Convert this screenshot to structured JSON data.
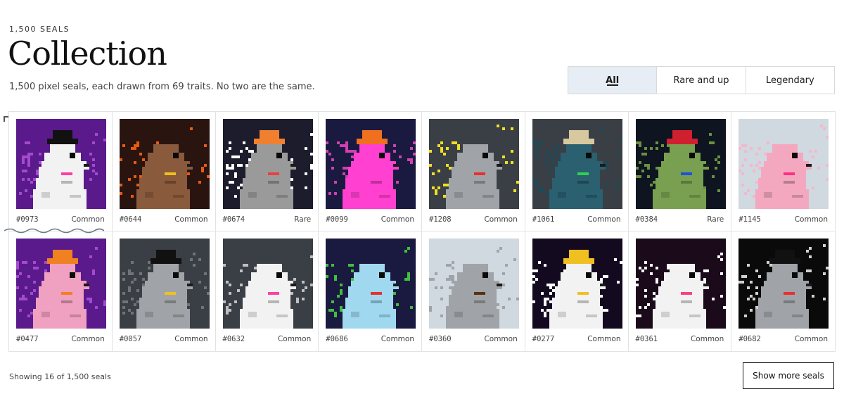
{
  "header": {
    "eyebrow": "1,500 SEALS",
    "title": "Collection",
    "subtitle": "1,500 pixel seals, each drawn from 69 traits. No two are the same."
  },
  "filters": [
    {
      "label": "All",
      "active": true
    },
    {
      "label": "Rare and up",
      "active": false
    },
    {
      "label": "Legendary",
      "active": false
    }
  ],
  "seals": [
    {
      "id": "#0973",
      "rarity": "Common",
      "bg": "#5a1a8c",
      "body": "#f2f2f2",
      "accent": "#ff3fa0",
      "hat": "#111111",
      "trail": "#a34ad0"
    },
    {
      "id": "#0644",
      "rarity": "Common",
      "bg": "#2a1410",
      "body": "#8a5a3c",
      "accent": "#f0c020",
      "hat": "",
      "trail": "#e85a10"
    },
    {
      "id": "#0674",
      "rarity": "Rare",
      "bg": "#1c1c2c",
      "body": "#9a9a9a",
      "accent": "#e84040",
      "hat": "#f08030",
      "trail": "#ffffff"
    },
    {
      "id": "#0099",
      "rarity": "Common",
      "bg": "#1a1a40",
      "body": "#ff40d0",
      "accent": "#ff40d0",
      "hat": "#f07020",
      "trail": "#d040b0"
    },
    {
      "id": "#1208",
      "rarity": "Common",
      "bg": "#3a3f46",
      "body": "#a0a4a8",
      "accent": "#e83030",
      "hat": "",
      "trail": "#f0e020"
    },
    {
      "id": "#1061",
      "rarity": "Common",
      "bg": "#3a3f46",
      "body": "#2a6070",
      "accent": "#30d050",
      "hat": "#d8c8a0",
      "trail": "#1a4a5a"
    },
    {
      "id": "#0384",
      "rarity": "Rare",
      "bg": "#0e1420",
      "body": "#78a050",
      "accent": "#2050e0",
      "hat": "#d02030",
      "trail": "#6a9040"
    },
    {
      "id": "#1145",
      "rarity": "Common",
      "bg": "#d0d8e0",
      "body": "#f4a8c0",
      "accent": "#ff3080",
      "hat": "",
      "trail": "#f4b8cc"
    },
    {
      "id": "#0477",
      "rarity": "Common",
      "bg": "#5a1a8c",
      "body": "#f0a0c0",
      "accent": "#f08020",
      "hat": "#f08020",
      "trail": "#a34ad0"
    },
    {
      "id": "#0057",
      "rarity": "Common",
      "bg": "#3a3f46",
      "body": "#a0a4a8",
      "accent": "#f0c020",
      "hat": "#111111",
      "trail": "#707478"
    },
    {
      "id": "#0632",
      "rarity": "Common",
      "bg": "#3a3f46",
      "body": "#f2f2f2",
      "accent": "#ff40a0",
      "hat": "",
      "trail": "#c0c0c0"
    },
    {
      "id": "#0686",
      "rarity": "Common",
      "bg": "#1a1a40",
      "body": "#a0d8f0",
      "accent": "#e83030",
      "hat": "",
      "trail": "#40c040"
    },
    {
      "id": "#0360",
      "rarity": "Common",
      "bg": "#d0d8e0",
      "body": "#a0a4a8",
      "accent": "#5a3010",
      "hat": "",
      "trail": "#a0a4a8"
    },
    {
      "id": "#0277",
      "rarity": "Common",
      "bg": "#140a20",
      "body": "#f2f2f2",
      "accent": "#f0c020",
      "hat": "#f0c020",
      "trail": "#ffffff"
    },
    {
      "id": "#0361",
      "rarity": "Common",
      "bg": "#1a0a1a",
      "body": "#f2f2f2",
      "accent": "#ff4080",
      "hat": "",
      "trail": "#ffffff"
    },
    {
      "id": "#0682",
      "rarity": "Common",
      "bg": "#0a0a0a",
      "body": "#a0a4a8",
      "accent": "#e83030",
      "hat": "#111111",
      "trail": "#d0d0d0"
    }
  ],
  "footer": {
    "showing": "Showing 16 of 1,500 seals",
    "more_label": "Show more seals"
  }
}
